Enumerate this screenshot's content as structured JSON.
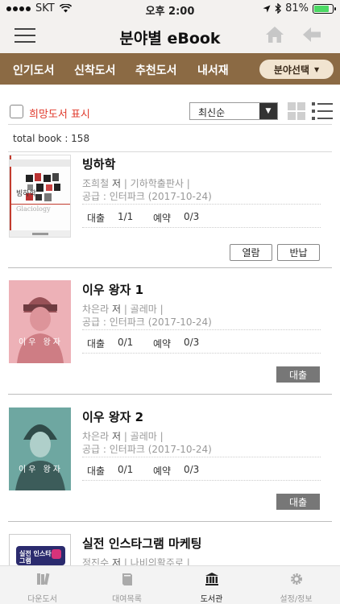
{
  "status_bar": {
    "carrier": "SKT",
    "time": "오후 2:00",
    "battery": "81%",
    "battery_level": 0.81
  },
  "header": {
    "title": "분야별 eBook"
  },
  "categories": {
    "tabs": [
      "인기도서",
      "신착도서",
      "추천도서",
      "내서재"
    ],
    "field_select": "분야선택"
  },
  "filter": {
    "wishlist_label": "희망도서 표시",
    "sort_value": "최신순"
  },
  "total_label": "total book : 158",
  "books": [
    {
      "title": "빙하학",
      "author": "조희철",
      "author_suffix": "저",
      "publisher": "기하학출판사",
      "supply": "공급 : 인터파크 (2017-10-24)",
      "loan_label": "대출",
      "loan_value": "1/1",
      "reserve_label": "예약",
      "reserve_value": "0/3",
      "open_label": "열람",
      "return_label": "반납",
      "cover_text": "빙하학",
      "cover_subtext": "Glaciology"
    },
    {
      "title": "이우 왕자 1",
      "author": "차은라",
      "author_suffix": "저",
      "publisher": "골레마",
      "supply": "공급 : 인터파크 (2017-10-24)",
      "loan_label": "대출",
      "loan_value": "0/1",
      "reserve_label": "예약",
      "reserve_value": "0/3",
      "action_label": "대출",
      "cover_text": "이우 왕자"
    },
    {
      "title": "이우 왕자 2",
      "author": "차은라",
      "author_suffix": "저",
      "publisher": "골레마",
      "supply": "공급 : 인터파크 (2017-10-24)",
      "loan_label": "대출",
      "loan_value": "0/1",
      "reserve_label": "예약",
      "reserve_value": "0/3",
      "action_label": "대출",
      "cover_text": "이우 왕자"
    },
    {
      "title": "실전 인스타그램 마케팅",
      "author": "정진수",
      "author_suffix": "저",
      "publisher": "나비의활주로",
      "cover_text": "실전 인스타그램"
    }
  ],
  "tabbar": {
    "items": [
      "다운도서",
      "대여목록",
      "도서관",
      "설정/정보"
    ],
    "active": "도서관"
  },
  "colors": {
    "category_bar": "#8b6a44",
    "wishlist_label": "#e03a2c",
    "loan_button": "#777777"
  }
}
